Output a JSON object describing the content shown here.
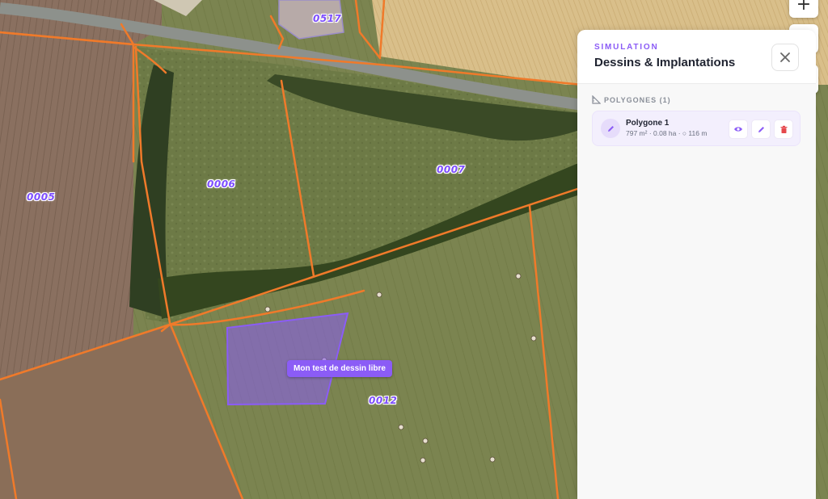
{
  "map": {
    "parcels": [
      {
        "id": "p0517",
        "label": "0517"
      },
      {
        "id": "p0005",
        "label": "0005"
      },
      {
        "id": "p0006",
        "label": "0006"
      },
      {
        "id": "p0007",
        "label": "0007"
      },
      {
        "id": "p0012",
        "label": "0012"
      }
    ],
    "polygon_tooltip": "Mon test de dessin libre",
    "zoom_in_label": "+",
    "colors": {
      "parcel_border": "#f07a2a",
      "polygon_fill": "#8b5cf6",
      "accent": "#8b5cf6"
    }
  },
  "panel": {
    "kicker": "SIMULATION",
    "title": "Dessins & Implantations",
    "close_icon": "close-icon",
    "section_title": "POLYGONES (1)",
    "items": [
      {
        "name": "Polygone 1",
        "meta": "797 m² · 0.08 ha · ○ 116 m",
        "icons": [
          "pencil-icon",
          "eye-icon",
          "edit-icon",
          "trash-icon"
        ]
      }
    ]
  }
}
